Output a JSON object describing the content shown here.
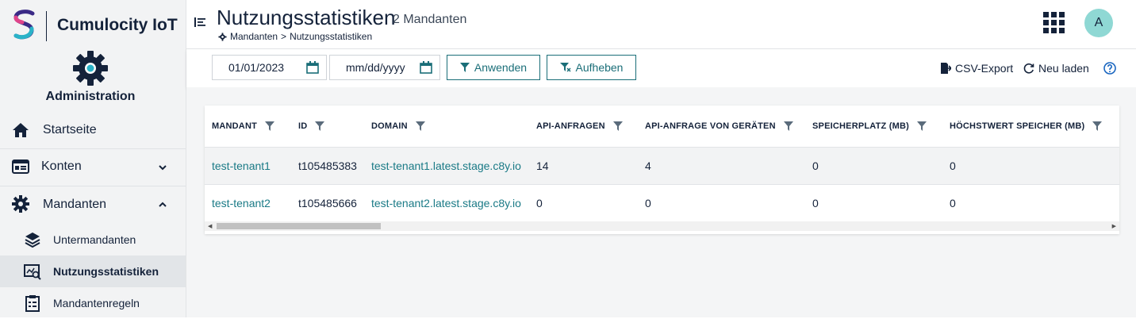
{
  "app": {
    "name": "Cumulocity IoT",
    "section": "Administration"
  },
  "sidebar": {
    "items": [
      {
        "label": "Startseite",
        "icon": "home-icon"
      },
      {
        "label": "Konten",
        "icon": "accounts-icon"
      },
      {
        "label": "Mandanten",
        "icon": "gear-icon"
      }
    ],
    "subitems": [
      {
        "label": "Untermandanten",
        "icon": "layers-icon"
      },
      {
        "label": "Nutzungsstatistiken",
        "icon": "usage-stats-icon"
      },
      {
        "label": "Mandantenregeln",
        "icon": "clipboard-icon"
      }
    ]
  },
  "header": {
    "title": "Nutzungsstatistiken",
    "subtitle": "2 Mandanten",
    "breadcrumb": {
      "parent": "Mandanten",
      "sep": ">",
      "current": "Nutzungsstatistiken"
    },
    "avatar_initial": "A"
  },
  "toolbar": {
    "date_from": "01/01/2023",
    "date_to_placeholder": "mm/dd/yyyy",
    "apply_label": "Anwenden",
    "clear_label": "Aufheben",
    "csv_label": "CSV-Export",
    "reload_label": "Neu laden"
  },
  "table": {
    "columns": [
      "MANDANT",
      "ID",
      "DOMAIN",
      "API-ANFRAGEN",
      "API-ANFRAGE VON GERÄTEN",
      "SPEICHERPLATZ (MB)",
      "HÖCHSTWERT SPEICHER (MB)"
    ],
    "rows": [
      [
        "test-tenant1",
        "t105485383",
        "test-tenant1.latest.stage.c8y.io",
        "14",
        "4",
        "0",
        "0"
      ],
      [
        "test-tenant2",
        "t105485666",
        "test-tenant2.latest.stage.c8y.io",
        "0",
        "0",
        "0",
        "0"
      ]
    ]
  },
  "colors": {
    "accent": "#1a7a86",
    "text": "#14223a",
    "avatar": "#8fd8d4"
  }
}
